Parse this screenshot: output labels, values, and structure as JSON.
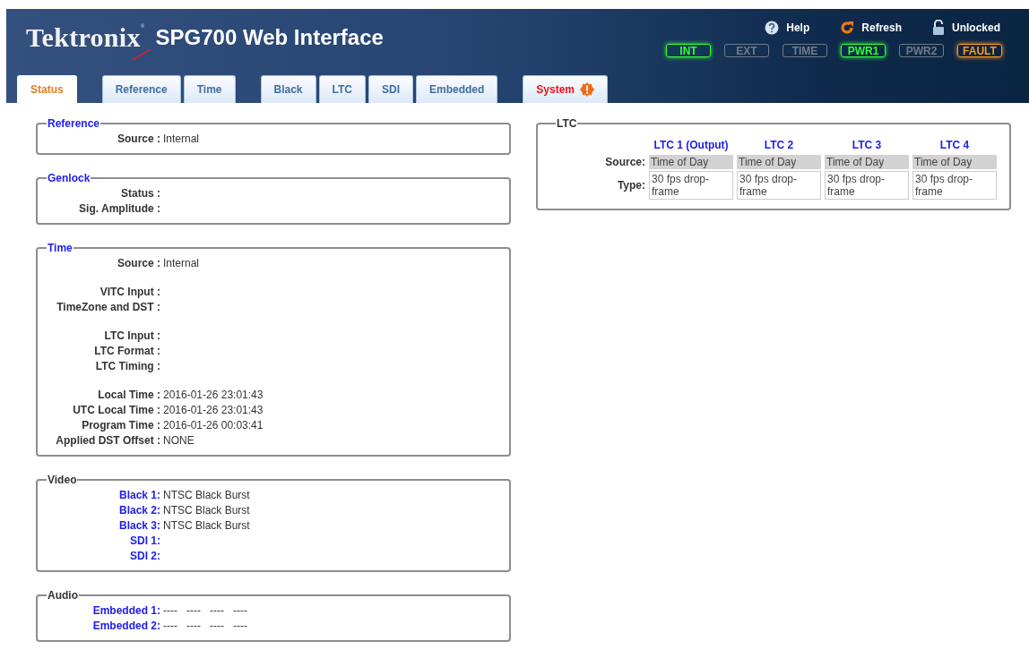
{
  "header": {
    "brand": "Tektronix",
    "registered": "®",
    "title": "SPG700 Web Interface",
    "actions": [
      {
        "kind": "help",
        "label": "Help"
      },
      {
        "kind": "refresh",
        "label": "Refresh"
      },
      {
        "kind": "lock",
        "label": "Unlocked"
      }
    ],
    "indicators": [
      {
        "label": "INT",
        "on": true,
        "color": "#33ff33"
      },
      {
        "label": "EXT",
        "on": false,
        "color": "#6f7c8a"
      },
      {
        "label": "TIME",
        "on": false,
        "color": "#6f7c8a"
      },
      {
        "label": "PWR1",
        "on": true,
        "color": "#33ff33"
      },
      {
        "label": "PWR2",
        "on": false,
        "color": "#6f7c8a"
      },
      {
        "label": "FAULT",
        "on": true,
        "color": "#ff9a1a"
      }
    ]
  },
  "tab_groups": [
    [
      {
        "label": "Status",
        "selected": true,
        "alert": false
      }
    ],
    [
      {
        "label": "Reference",
        "selected": false,
        "alert": false
      },
      {
        "label": "Time",
        "selected": false,
        "alert": false
      }
    ],
    [
      {
        "label": "Black",
        "selected": false,
        "alert": false
      },
      {
        "label": "LTC",
        "selected": false,
        "alert": false
      },
      {
        "label": "SDI",
        "selected": false,
        "alert": false
      },
      {
        "label": "Embedded",
        "selected": false,
        "alert": false
      }
    ],
    [
      {
        "label": "System",
        "selected": false,
        "alert": true
      }
    ]
  ],
  "sections": [
    {
      "title": "Reference",
      "kind": "link",
      "groups": [
        [
          {
            "label": "Source :",
            "kind": "status",
            "value": "Internal"
          }
        ]
      ]
    },
    {
      "title": "Genlock",
      "kind": "link",
      "groups": [
        [
          {
            "label": "Status :",
            "kind": "status"
          },
          {
            "label": "Sig. Amplitude :",
            "kind": "status"
          }
        ]
      ]
    },
    {
      "title": "Time",
      "kind": "link",
      "groups": [
        [
          {
            "label": "Source :",
            "kind": "status",
            "value": "Internal"
          }
        ],
        [
          {
            "label": "VITC Input :",
            "kind": "status"
          },
          {
            "label": "TimeZone and DST :",
            "kind": "status"
          }
        ],
        [
          {
            "label": "LTC Input :",
            "kind": "status"
          },
          {
            "label": "LTC Format :",
            "kind": "status"
          },
          {
            "label": "LTC Timing :",
            "kind": "status"
          }
        ],
        [
          {
            "label": "Local Time :",
            "kind": "status",
            "value": "2016-01-26 23:01:43"
          },
          {
            "label": "UTC Local Time :",
            "kind": "status",
            "value": "2016-01-26 23:01:43"
          },
          {
            "label": "Program Time :",
            "kind": "status",
            "value": "2016-01-26 00:03:41"
          },
          {
            "label": "Applied DST Offset :",
            "kind": "status",
            "value": "NONE"
          }
        ]
      ]
    },
    {
      "title": "Video",
      "kind": "plain",
      "groups": [
        [
          {
            "label": "Black 1:",
            "kind": "channel",
            "value": "NTSC Black Burst"
          },
          {
            "label": "Black 2:",
            "kind": "channel",
            "value": "NTSC Black Burst"
          },
          {
            "label": "Black 3:",
            "kind": "channel",
            "value": "NTSC Black Burst"
          },
          {
            "label": "SDI 1:",
            "kind": "channel"
          },
          {
            "label": "SDI 2:",
            "kind": "channel"
          }
        ]
      ]
    },
    {
      "title": "Audio",
      "kind": "plain",
      "groups": [
        [
          {
            "label": "Embedded 1:",
            "kind": "channel",
            "values": [
              "----",
              "----",
              "----",
              "----"
            ]
          },
          {
            "label": "Embedded 2:",
            "kind": "channel",
            "values": [
              "----",
              "----",
              "----",
              "----"
            ]
          }
        ]
      ]
    }
  ],
  "ltc": {
    "title": "LTC",
    "columns": [
      "LTC 1 (Output)",
      "LTC 2",
      "LTC 3",
      "LTC 4"
    ],
    "rows": [
      {
        "label": "Source:",
        "kind": "shaded",
        "cells": [
          "Time of Day",
          "Time of Day",
          "Time of Day",
          "Time of Day"
        ]
      },
      {
        "label": "Type:",
        "kind": "boxed",
        "cells": [
          "30 fps drop-frame",
          "30 fps drop-frame",
          "30 fps drop-frame",
          "30 fps drop-frame"
        ]
      }
    ]
  }
}
